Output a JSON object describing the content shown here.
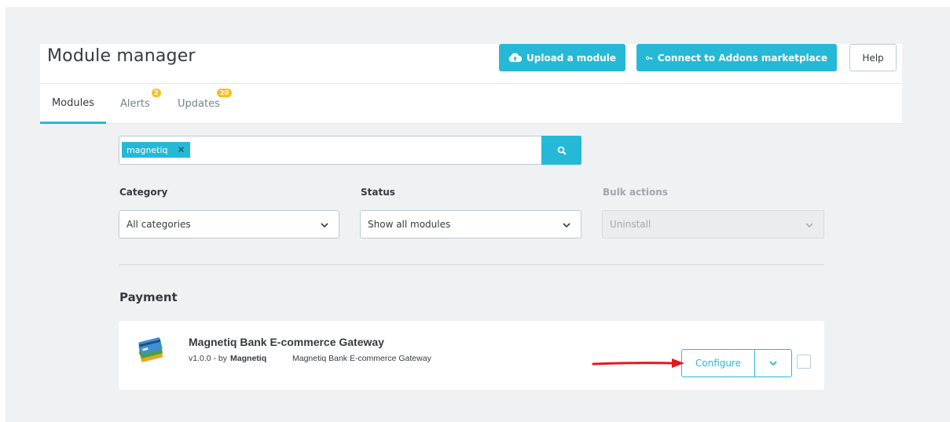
{
  "header": {
    "title": "Module manager",
    "upload_label": "Upload a module",
    "connect_label": "Connect to Addons marketplace",
    "help_label": "Help"
  },
  "tabs": [
    {
      "label": "Modules",
      "active": true
    },
    {
      "label": "Alerts",
      "badge": "2"
    },
    {
      "label": "Updates",
      "badge": "20"
    }
  ],
  "search": {
    "tag": "magnetiq",
    "tag_remove": "✕"
  },
  "filters": {
    "category": {
      "label": "Category",
      "value": "All categories"
    },
    "status": {
      "label": "Status",
      "value": "Show all modules"
    },
    "bulk": {
      "label": "Bulk actions",
      "value": "Uninstall"
    }
  },
  "section": {
    "title": "Payment"
  },
  "module": {
    "name": "Magnetiq Bank E-commerce Gateway",
    "version": "v1.0.0 - by",
    "author": "Magnetiq",
    "description": "Magnetiq Bank E-commerce Gateway",
    "configure_label": "Configure"
  },
  "colors": {
    "accent": "#25b9d7",
    "badge": "#fbbb22",
    "annotation_arrow": "#e4191c"
  },
  "icons": {
    "upload": "cloud-upload-icon",
    "connect": "key-icon",
    "search": "search-icon",
    "dropdown": "chevron-down-icon"
  }
}
